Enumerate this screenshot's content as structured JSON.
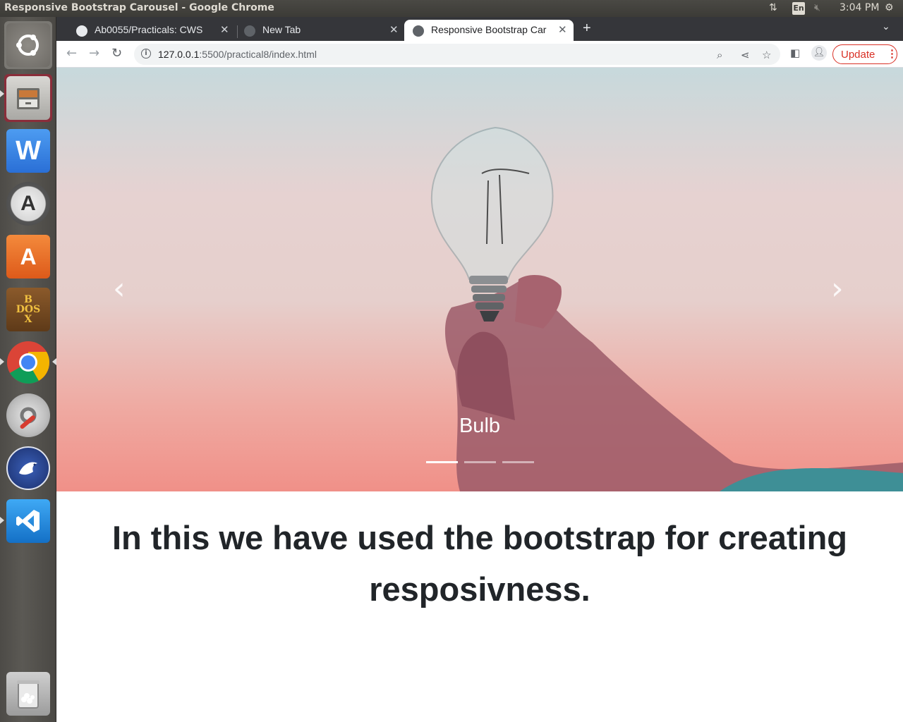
{
  "os": {
    "window_title": "Responsive Bootstrap Carousel - Google Chrome",
    "keyboard_layout": "En",
    "clock": "3:04 PM"
  },
  "launcher": {
    "items": [
      "Ubuntu Dash",
      "Files",
      "WPS Writer",
      "Software Updater",
      "Ubuntu Software",
      "DOSBox",
      "Google Chrome",
      "System Settings",
      "Thunderbird",
      "Visual Studio Code",
      "Trash"
    ]
  },
  "browser": {
    "tabs": [
      {
        "label": "Ab0055/Practicals: CWS",
        "close": "✕"
      },
      {
        "label": "New Tab",
        "close": "✕"
      },
      {
        "label": "Responsive Bootstrap Car",
        "close": "✕"
      }
    ],
    "new_tab": "+",
    "url_host": "127.0.0.1",
    "url_rest": ":5500/practical8/index.html",
    "update_label": "Update"
  },
  "page": {
    "carousel": {
      "caption": "Bulb",
      "prev": "‹",
      "next": "›",
      "slide_count": 3,
      "active_slide": 1
    },
    "headline": "In this we have used the bootstrap for creating resposivness."
  },
  "colors": {
    "accent_update": "#d93025",
    "tab_strip": "#35363a",
    "headline": "#212529"
  }
}
